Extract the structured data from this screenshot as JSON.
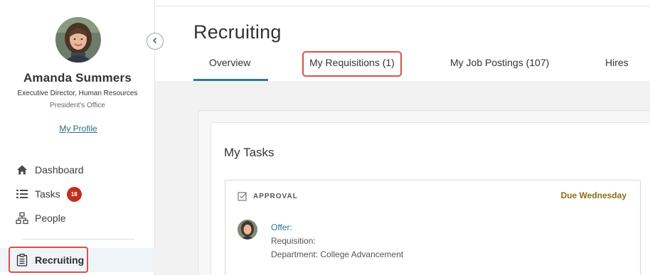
{
  "profile": {
    "name": "Amanda Summers",
    "title": "Executive Director, Human Resources",
    "department": "President's Office",
    "link_label": "My Profile"
  },
  "nav": {
    "items": [
      {
        "label": "Dashboard",
        "icon": "home-icon"
      },
      {
        "label": "Tasks",
        "icon": "list-icon",
        "badge": "18"
      },
      {
        "label": "People",
        "icon": "org-chart-icon"
      }
    ],
    "active": {
      "label": "Recruiting",
      "icon": "clipboard-icon"
    }
  },
  "page": {
    "title": "Recruiting"
  },
  "tabs": [
    {
      "label": "Overview",
      "active": true
    },
    {
      "label": "My Requisitions (1)",
      "highlighted": true
    },
    {
      "label": "My Job Postings (107)"
    },
    {
      "label": "Hires"
    }
  ],
  "tasks": {
    "title": "My Tasks",
    "items": [
      {
        "type": "APPROVAL",
        "due": "Due Wednesday",
        "offer_label": "Offer:",
        "requisition_label": "Requisition:",
        "department_label": "Department: College Advancement"
      }
    ]
  },
  "colors": {
    "accent": "#2a7f8c",
    "highlight": "#d9504a",
    "badge": "#c0301e",
    "due": "#8a6d14",
    "link": "#2e6d83"
  }
}
